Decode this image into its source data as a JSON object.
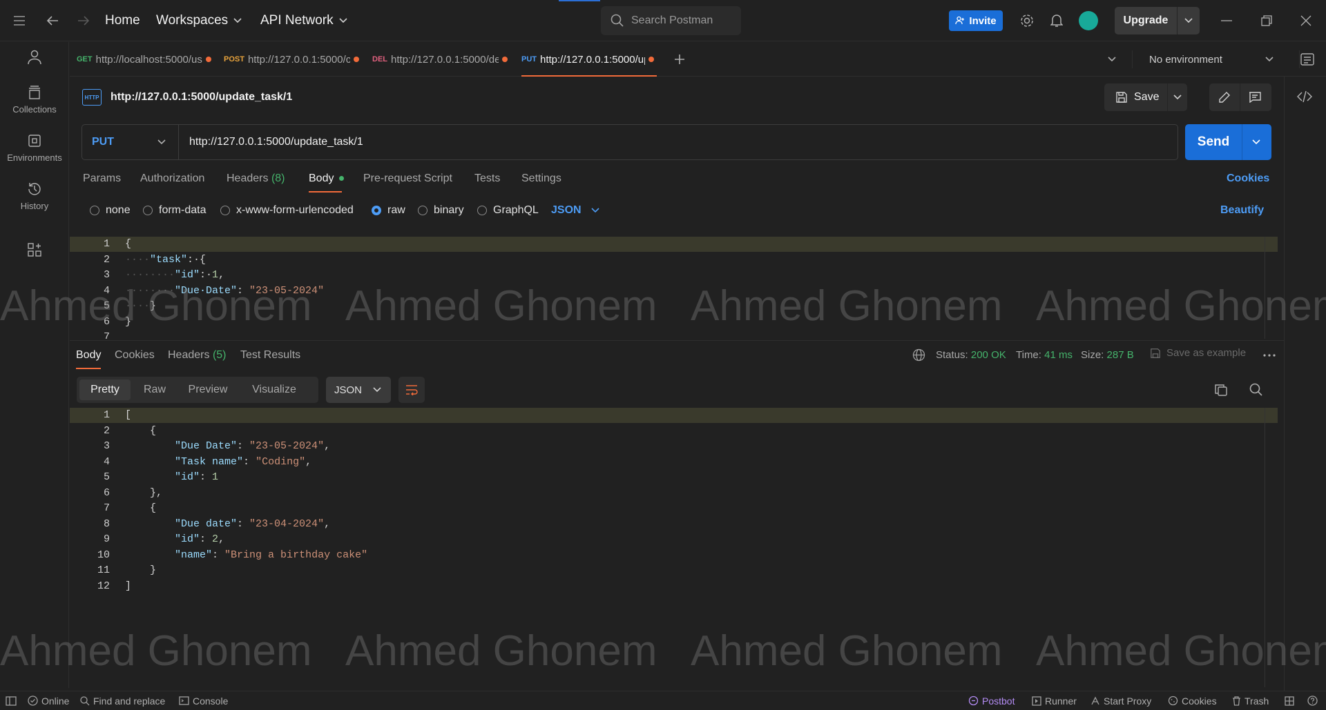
{
  "topbar": {
    "home": "Home",
    "workspaces": "Workspaces",
    "api_network": "API Network",
    "search_placeholder": "Search Postman",
    "invite": "Invite",
    "upgrade": "Upgrade"
  },
  "sidebar": {
    "collections": "Collections",
    "environments": "Environments",
    "history": "History"
  },
  "tabs": [
    {
      "method": "GET",
      "method_color": "#45b36b",
      "url": "http://localhost:5000/us"
    },
    {
      "method": "POST",
      "method_color": "#e8a33c",
      "url": "http://127.0.0.1:5000/c"
    },
    {
      "method": "DEL",
      "method_color": "#e0607e",
      "url": "http://127.0.0.1:5000/de"
    },
    {
      "method": "PUT",
      "method_color": "#4d9cf5",
      "url": "http://127.0.0.1:5000/up"
    }
  ],
  "environment": "No environment",
  "request": {
    "title": "http://127.0.0.1:5000/update_task/1",
    "save": "Save",
    "method": "PUT",
    "url": "http://127.0.0.1:5000/update_task/1",
    "send": "Send"
  },
  "request_tabs": {
    "params": "Params",
    "authorization": "Authorization",
    "headers": "Headers",
    "headers_count": "(8)",
    "body": "Body",
    "prerequest": "Pre-request Script",
    "tests": "Tests",
    "settings": "Settings",
    "cookies": "Cookies"
  },
  "body_options": {
    "none": "none",
    "form_data": "form-data",
    "urlencoded": "x-www-form-urlencoded",
    "raw": "raw",
    "binary": "binary",
    "graphql": "GraphQL",
    "language": "JSON",
    "beautify": "Beautify"
  },
  "request_body": {
    "line_numbers": [
      "1",
      "2",
      "3",
      "4",
      "5",
      "6",
      "7"
    ],
    "lines": [
      [
        {
          "t": "{",
          "c": "p"
        }
      ],
      [
        {
          "t": "····",
          "c": "ws"
        },
        {
          "t": "\"task\"",
          "c": "k"
        },
        {
          "t": ":·{",
          "c": "p"
        }
      ],
      [
        {
          "t": "········",
          "c": "ws"
        },
        {
          "t": "\"id\"",
          "c": "k"
        },
        {
          "t": ":·",
          "c": "p"
        },
        {
          "t": "1",
          "c": "n"
        },
        {
          "t": ",",
          "c": "p"
        }
      ],
      [
        {
          "t": "········",
          "c": "ws"
        },
        {
          "t": "\"Due·Date\"",
          "c": "k"
        },
        {
          "t": ": ",
          "c": "p"
        },
        {
          "t": "\"23-05-2024\"",
          "c": "s"
        }
      ],
      [
        {
          "t": "····",
          "c": "ws"
        },
        {
          "t": "}",
          "c": "p"
        }
      ],
      [
        {
          "t": "}",
          "c": "p"
        }
      ],
      []
    ]
  },
  "response_tabs": {
    "body": "Body",
    "cookies": "Cookies",
    "headers": "Headers",
    "headers_count": "(5)",
    "test_results": "Test Results"
  },
  "response_status": {
    "status_label": "Status:",
    "status": "200 OK",
    "time_label": "Time:",
    "time": "41 ms",
    "size_label": "Size:",
    "size": "287 B",
    "save_example": "Save as example"
  },
  "response_format": {
    "pretty": "Pretty",
    "raw": "Raw",
    "preview": "Preview",
    "visualize": "Visualize",
    "language": "JSON"
  },
  "response_body": {
    "line_numbers": [
      "1",
      "2",
      "3",
      "4",
      "5",
      "6",
      "7",
      "8",
      "9",
      "10",
      "11",
      "12"
    ],
    "lines": [
      [
        {
          "t": "[",
          "c": "p"
        }
      ],
      [
        {
          "t": "    {",
          "c": "p"
        }
      ],
      [
        {
          "t": "        ",
          "c": "p"
        },
        {
          "t": "\"Due Date\"",
          "c": "k"
        },
        {
          "t": ": ",
          "c": "p"
        },
        {
          "t": "\"23-05-2024\"",
          "c": "s"
        },
        {
          "t": ",",
          "c": "p"
        }
      ],
      [
        {
          "t": "        ",
          "c": "p"
        },
        {
          "t": "\"Task name\"",
          "c": "k"
        },
        {
          "t": ": ",
          "c": "p"
        },
        {
          "t": "\"Coding\"",
          "c": "s"
        },
        {
          "t": ",",
          "c": "p"
        }
      ],
      [
        {
          "t": "        ",
          "c": "p"
        },
        {
          "t": "\"id\"",
          "c": "k"
        },
        {
          "t": ": ",
          "c": "p"
        },
        {
          "t": "1",
          "c": "n"
        }
      ],
      [
        {
          "t": "    },",
          "c": "p"
        }
      ],
      [
        {
          "t": "    {",
          "c": "p"
        }
      ],
      [
        {
          "t": "        ",
          "c": "p"
        },
        {
          "t": "\"Due date\"",
          "c": "k"
        },
        {
          "t": ": ",
          "c": "p"
        },
        {
          "t": "\"23-04-2024\"",
          "c": "s"
        },
        {
          "t": ",",
          "c": "p"
        }
      ],
      [
        {
          "t": "        ",
          "c": "p"
        },
        {
          "t": "\"id\"",
          "c": "k"
        },
        {
          "t": ": ",
          "c": "p"
        },
        {
          "t": "2",
          "c": "n"
        },
        {
          "t": ",",
          "c": "p"
        }
      ],
      [
        {
          "t": "        ",
          "c": "p"
        },
        {
          "t": "\"name\"",
          "c": "k"
        },
        {
          "t": ": ",
          "c": "p"
        },
        {
          "t": "\"Bring a birthday cake\"",
          "c": "s"
        }
      ],
      [
        {
          "t": "    }",
          "c": "p"
        }
      ],
      [
        {
          "t": "]",
          "c": "p"
        }
      ]
    ]
  },
  "watermark": "Ahmed Ghonem",
  "statusbar": {
    "online": "Online",
    "find_replace": "Find and replace",
    "console": "Console",
    "postbot": "Postbot",
    "runner": "Runner",
    "start_proxy": "Start Proxy",
    "cookies": "Cookies",
    "trash": "Trash"
  },
  "colors": {
    "accent_orange": "#f26b3a",
    "send_blue": "#1a6ed8",
    "success_green": "#45b36b",
    "postbot_purple": "#b48cf5"
  }
}
